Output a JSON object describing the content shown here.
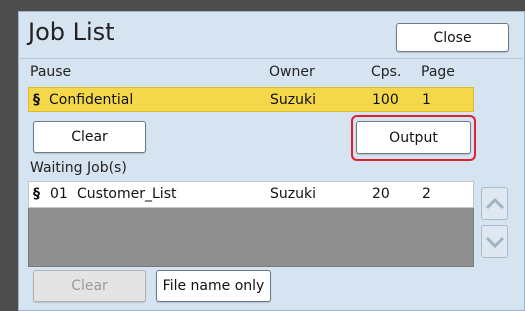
{
  "header": {
    "title": "Job List",
    "close_label": "Close"
  },
  "pause_section": {
    "columns": {
      "name": "Pause",
      "owner": "Owner",
      "copies": "Cps.",
      "page": "Page"
    },
    "job": {
      "icon": "§",
      "name": "Confidential",
      "owner": "Suzuki",
      "copies": "100",
      "page": "1"
    }
  },
  "actions": {
    "clear_label": "Clear",
    "output_label": "Output"
  },
  "waiting_section": {
    "label": "Waiting Job(s)",
    "jobs": [
      {
        "icon": "§",
        "number": "01",
        "name": "Customer_List",
        "owner": "Suzuki",
        "copies": "20",
        "page": "2"
      }
    ]
  },
  "footer": {
    "clear_label": "Clear",
    "file_name_only_label": "File name only"
  },
  "colors": {
    "selected_row": "#f4d84a",
    "highlight_ring": "#e2202b",
    "panel_bg": "#d6e4f1"
  },
  "icons": {
    "scroll_up": "chevron-up-icon",
    "scroll_down": "chevron-down-icon"
  }
}
